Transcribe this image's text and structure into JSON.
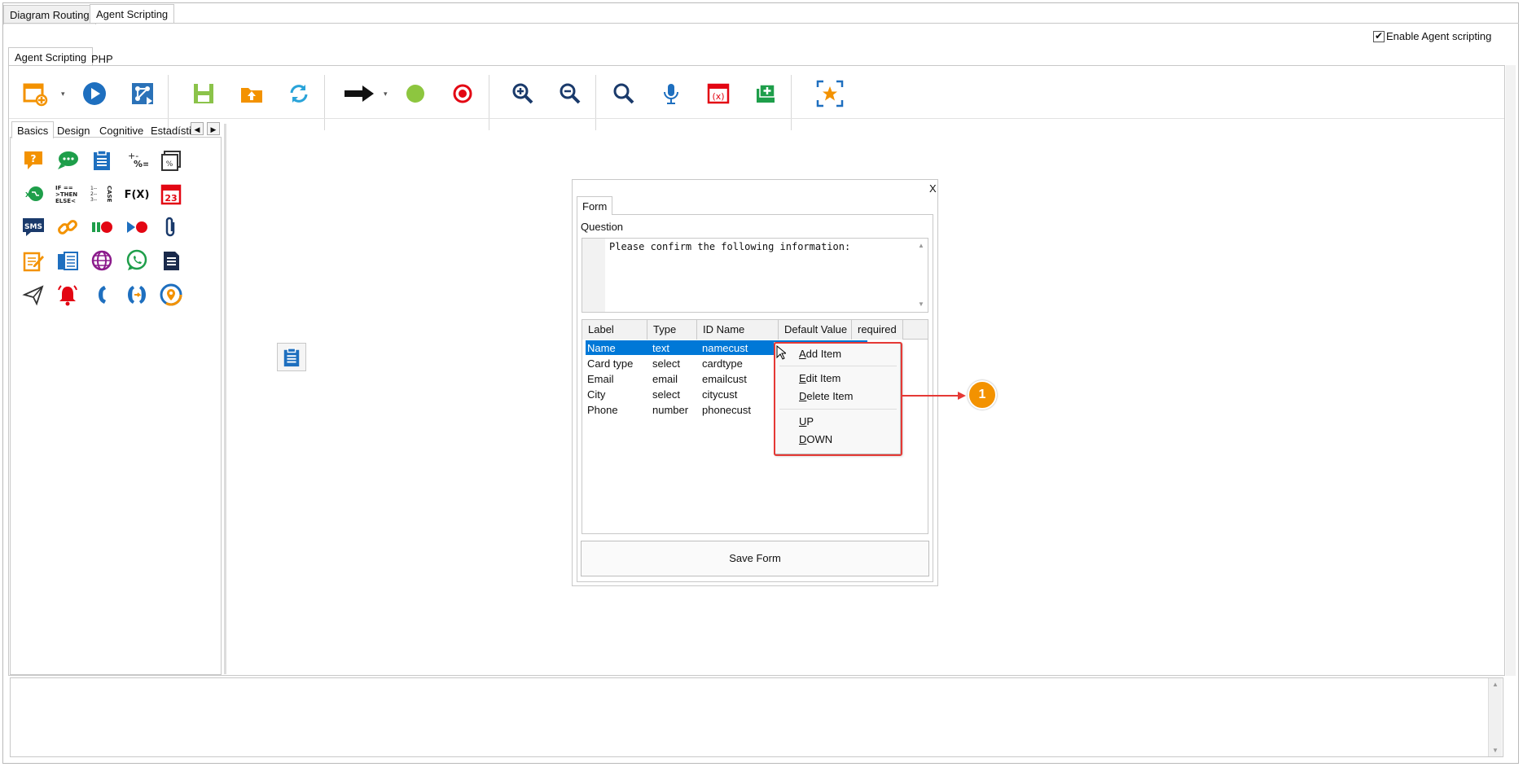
{
  "top_tabs": [
    "Diagram Routing",
    "Agent Scripting"
  ],
  "enable_label": "Enable Agent scripting",
  "sub_tabs": [
    "Agent Scripting",
    "PHP"
  ],
  "toolbar": [
    "new-diagram-icon",
    "dropdown-arrow-icon",
    "play-icon",
    "flow-diagram-icon",
    "save-icon",
    "open-folder-icon",
    "refresh-icon",
    "arrow-connector-icon",
    "dropdown-arrow-icon",
    "start-node-icon",
    "end-node-icon",
    "zoom-in-icon",
    "zoom-out-icon",
    "search-icon",
    "microphone-icon",
    "variables-icon",
    "add-folder-icon",
    "fit-screen-icon"
  ],
  "palette_tabs": [
    "Basics",
    "Design",
    "Cognitive",
    "Estadísti"
  ],
  "palette_icons": [
    "question-icon",
    "message-icon",
    "clipboard-icon",
    "calculator-icon",
    "image-icon",
    "web-service-icon",
    "if-then-else-icon",
    "case-icon",
    "function-icon",
    "calendar-icon",
    "sms-icon",
    "link-icon",
    "record-pause-icon",
    "record-play-icon",
    "attachment-icon",
    "note-edit-icon",
    "fax-icon",
    "globe-icon",
    "whatsapp-icon",
    "document-icon",
    "send-icon",
    "alarm-bell-icon",
    "phone-icon",
    "transfer-call-icon",
    "location-icon"
  ],
  "form": {
    "close": "X",
    "tab": "Form",
    "question_label": "Question",
    "question_text": "Please confirm the following information:",
    "columns": [
      "Label",
      "Type",
      "ID Name",
      "Default Value",
      "required"
    ],
    "rows": [
      [
        "Name",
        "text",
        "namecust"
      ],
      [
        "Card type",
        "select",
        "cardtype"
      ],
      [
        "Email",
        "email",
        "emailcust"
      ],
      [
        "City",
        "select",
        "citycust"
      ],
      [
        "Phone",
        "number",
        "phonecust"
      ]
    ],
    "save_button": "Save Form"
  },
  "context_menu": [
    {
      "u": "A",
      "rest": "dd Item"
    },
    {
      "u": "E",
      "rest": "dit Item"
    },
    {
      "u": "D",
      "rest": "elete Item"
    },
    {
      "u": "U",
      "rest": "P"
    },
    {
      "u": "D",
      "rest": "OWN"
    }
  ],
  "callout": "1",
  "colors": {
    "accent": "#e53935",
    "callout": "#f39200",
    "selection": "#0078d7"
  }
}
